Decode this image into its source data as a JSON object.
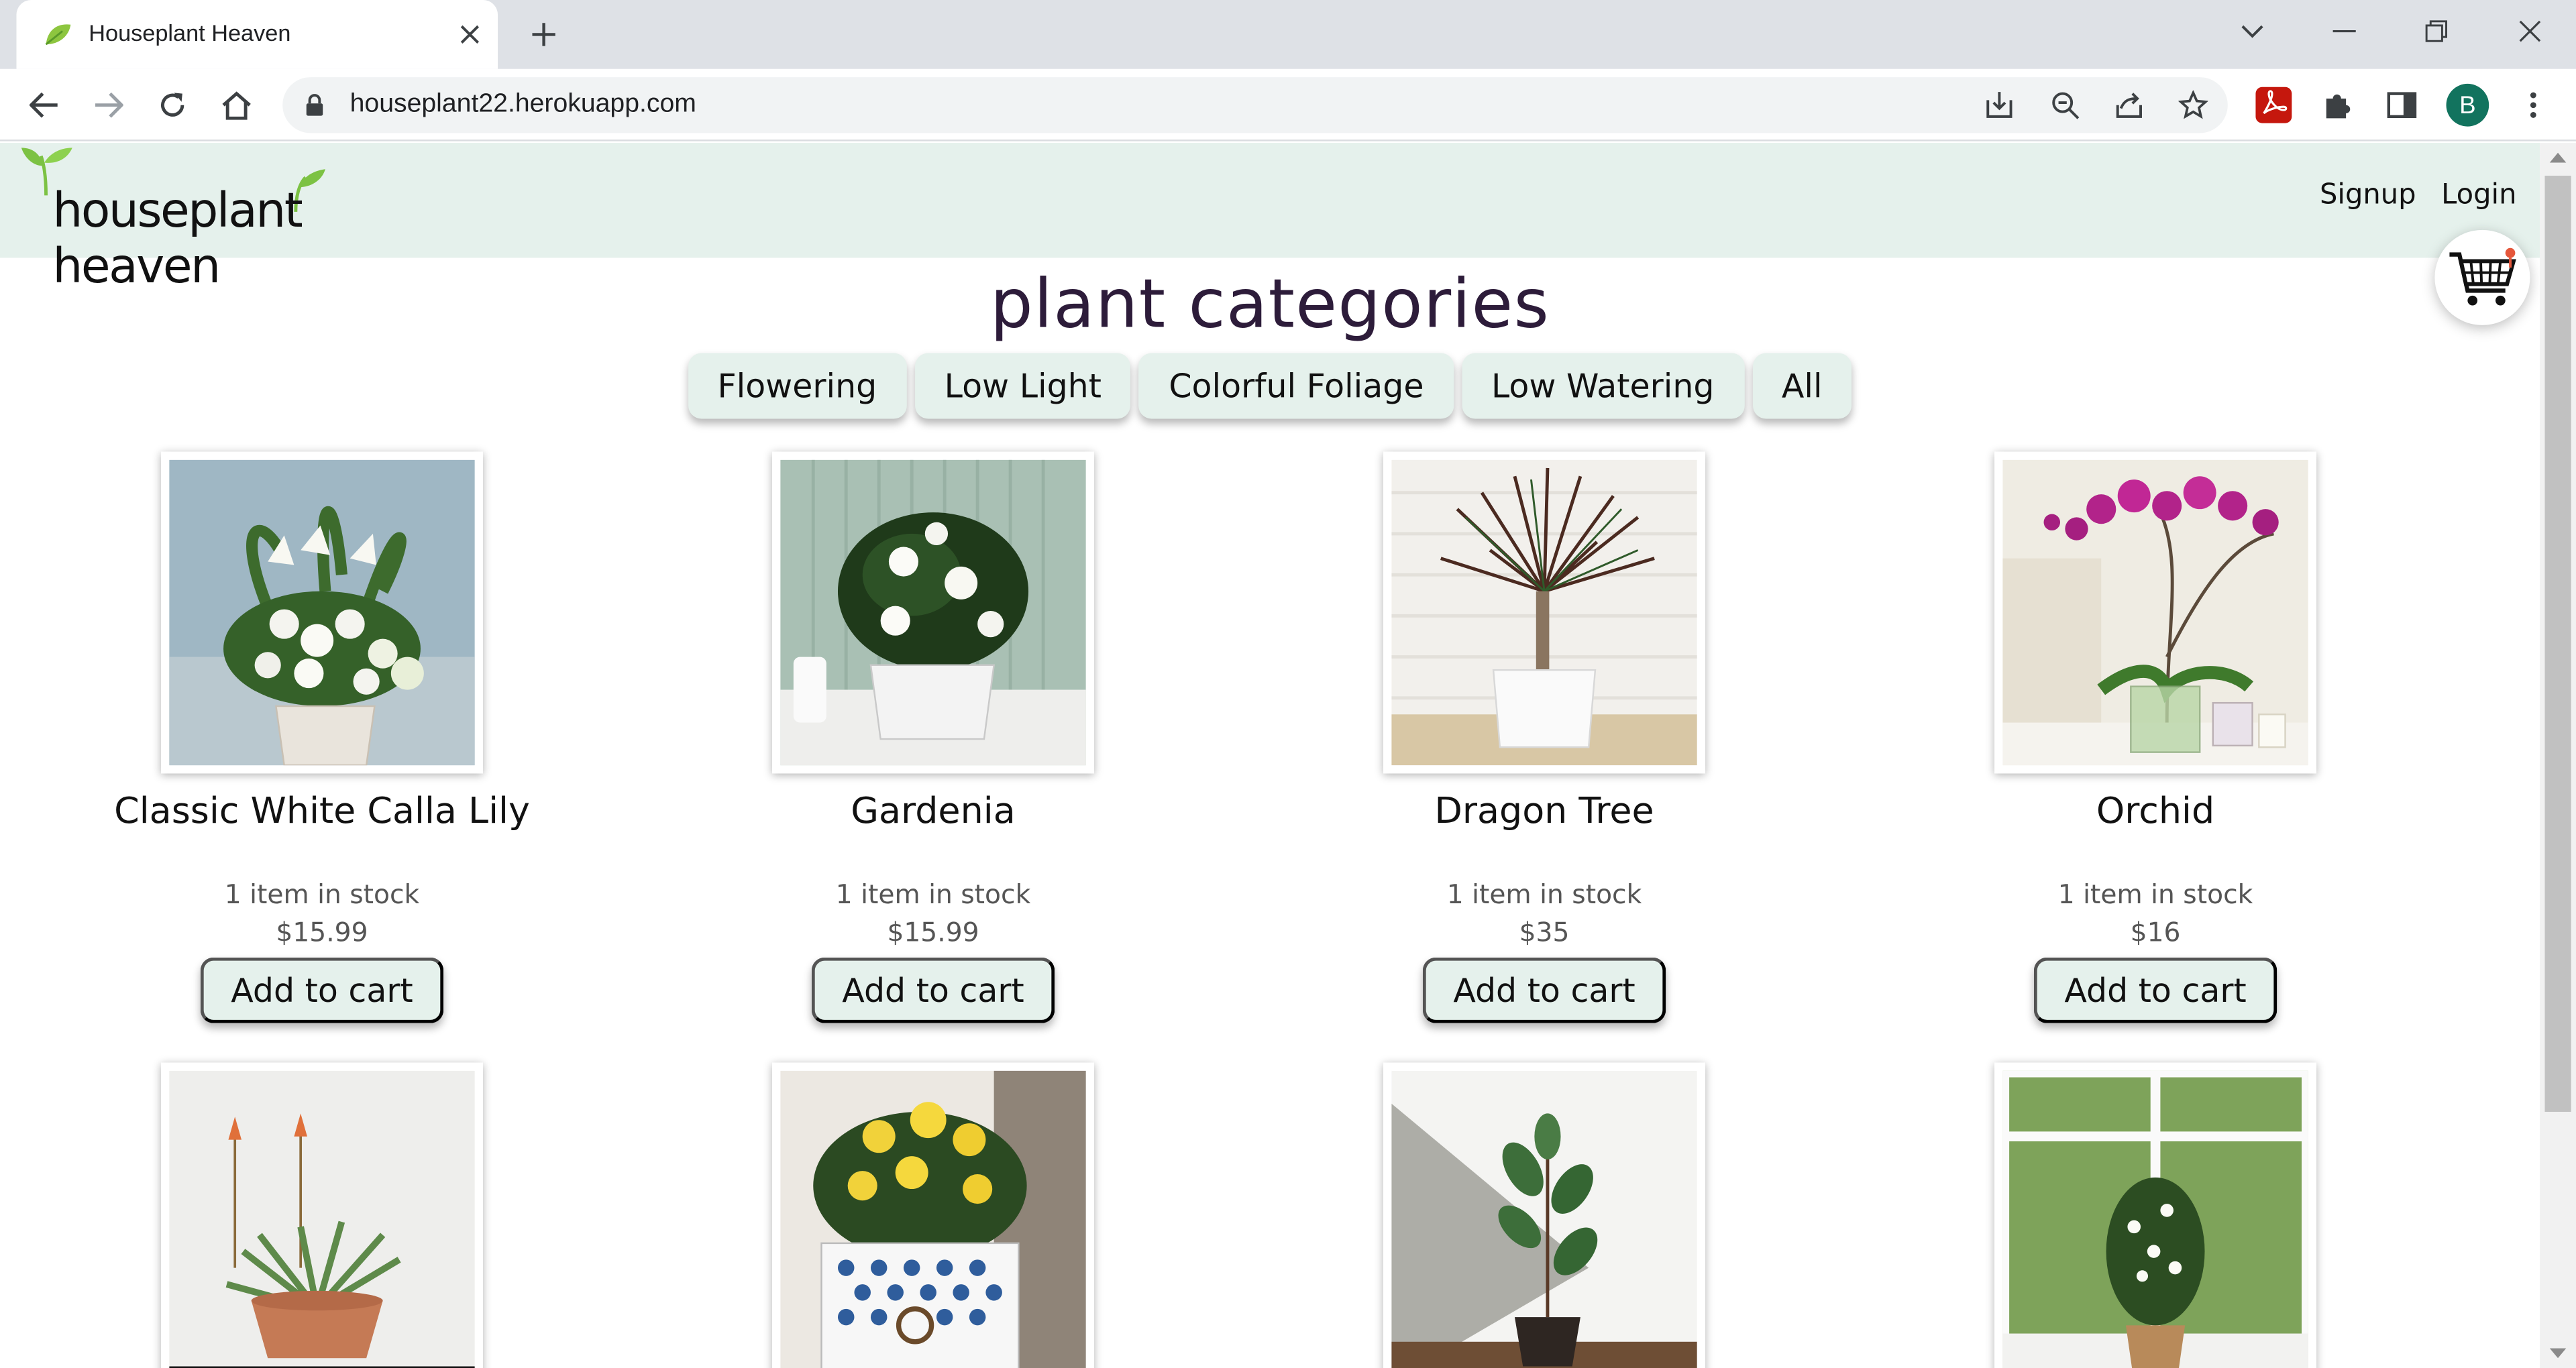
{
  "browser": {
    "tab_title": "Houseplant Heaven",
    "url": "houseplant22.herokuapp.com",
    "profile_initial": "B"
  },
  "site": {
    "logo_text": "houseplant heaven",
    "nav": {
      "signup": "Signup",
      "login": "Login"
    },
    "heading": "plant categories",
    "categories": [
      "Flowering",
      "Low Light",
      "Colorful Foliage",
      "Low Watering",
      "All"
    ]
  },
  "products": [
    {
      "name": "Classic White Calla Lily",
      "stock": "1 item in stock",
      "price": "$15.99",
      "button": "Add to cart"
    },
    {
      "name": "Gardenia",
      "stock": "1 item in stock",
      "price": "$15.99",
      "button": "Add to cart"
    },
    {
      "name": "Dragon Tree",
      "stock": "1 item in stock",
      "price": "$35",
      "button": "Add to cart"
    },
    {
      "name": "Orchid",
      "stock": "1 item in stock",
      "price": "$16",
      "button": "Add to cart"
    }
  ],
  "colors": {
    "header_bg": "#e5f1ec",
    "button_bg": "#e5f1ec",
    "heading": "#2d1c3a",
    "logo_leaf": "#7cc243"
  }
}
